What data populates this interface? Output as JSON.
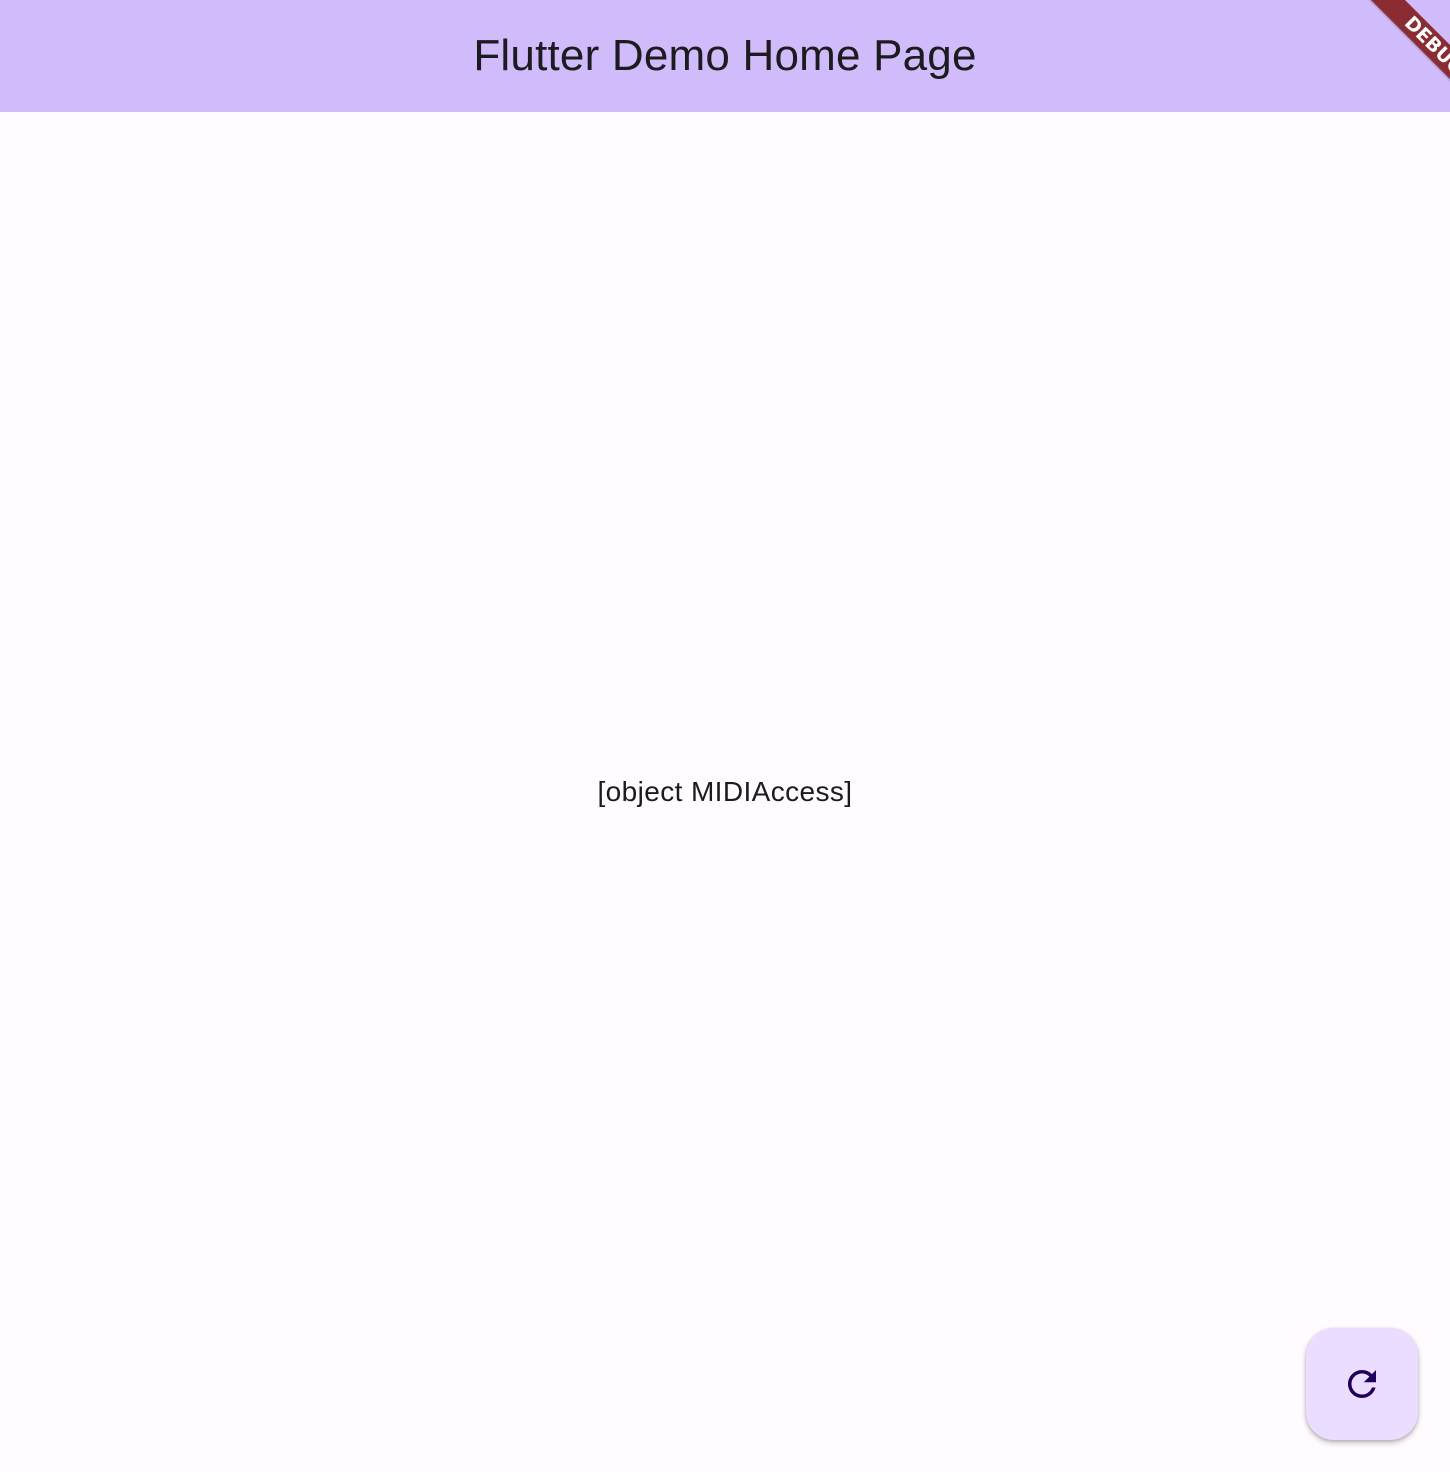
{
  "app_bar": {
    "title": "Flutter Demo Home Page"
  },
  "debug_banner": {
    "label": "DEBUG"
  },
  "main": {
    "status_text": "[object MIDIAccess]"
  },
  "fab": {
    "icon": "refresh-icon"
  },
  "colors": {
    "app_bar_background": "#d0bcfa",
    "page_background": "#fffbfe",
    "fab_background": "#eaddff",
    "fab_icon": "#21005d",
    "debug_banner": "#8b2b32"
  }
}
